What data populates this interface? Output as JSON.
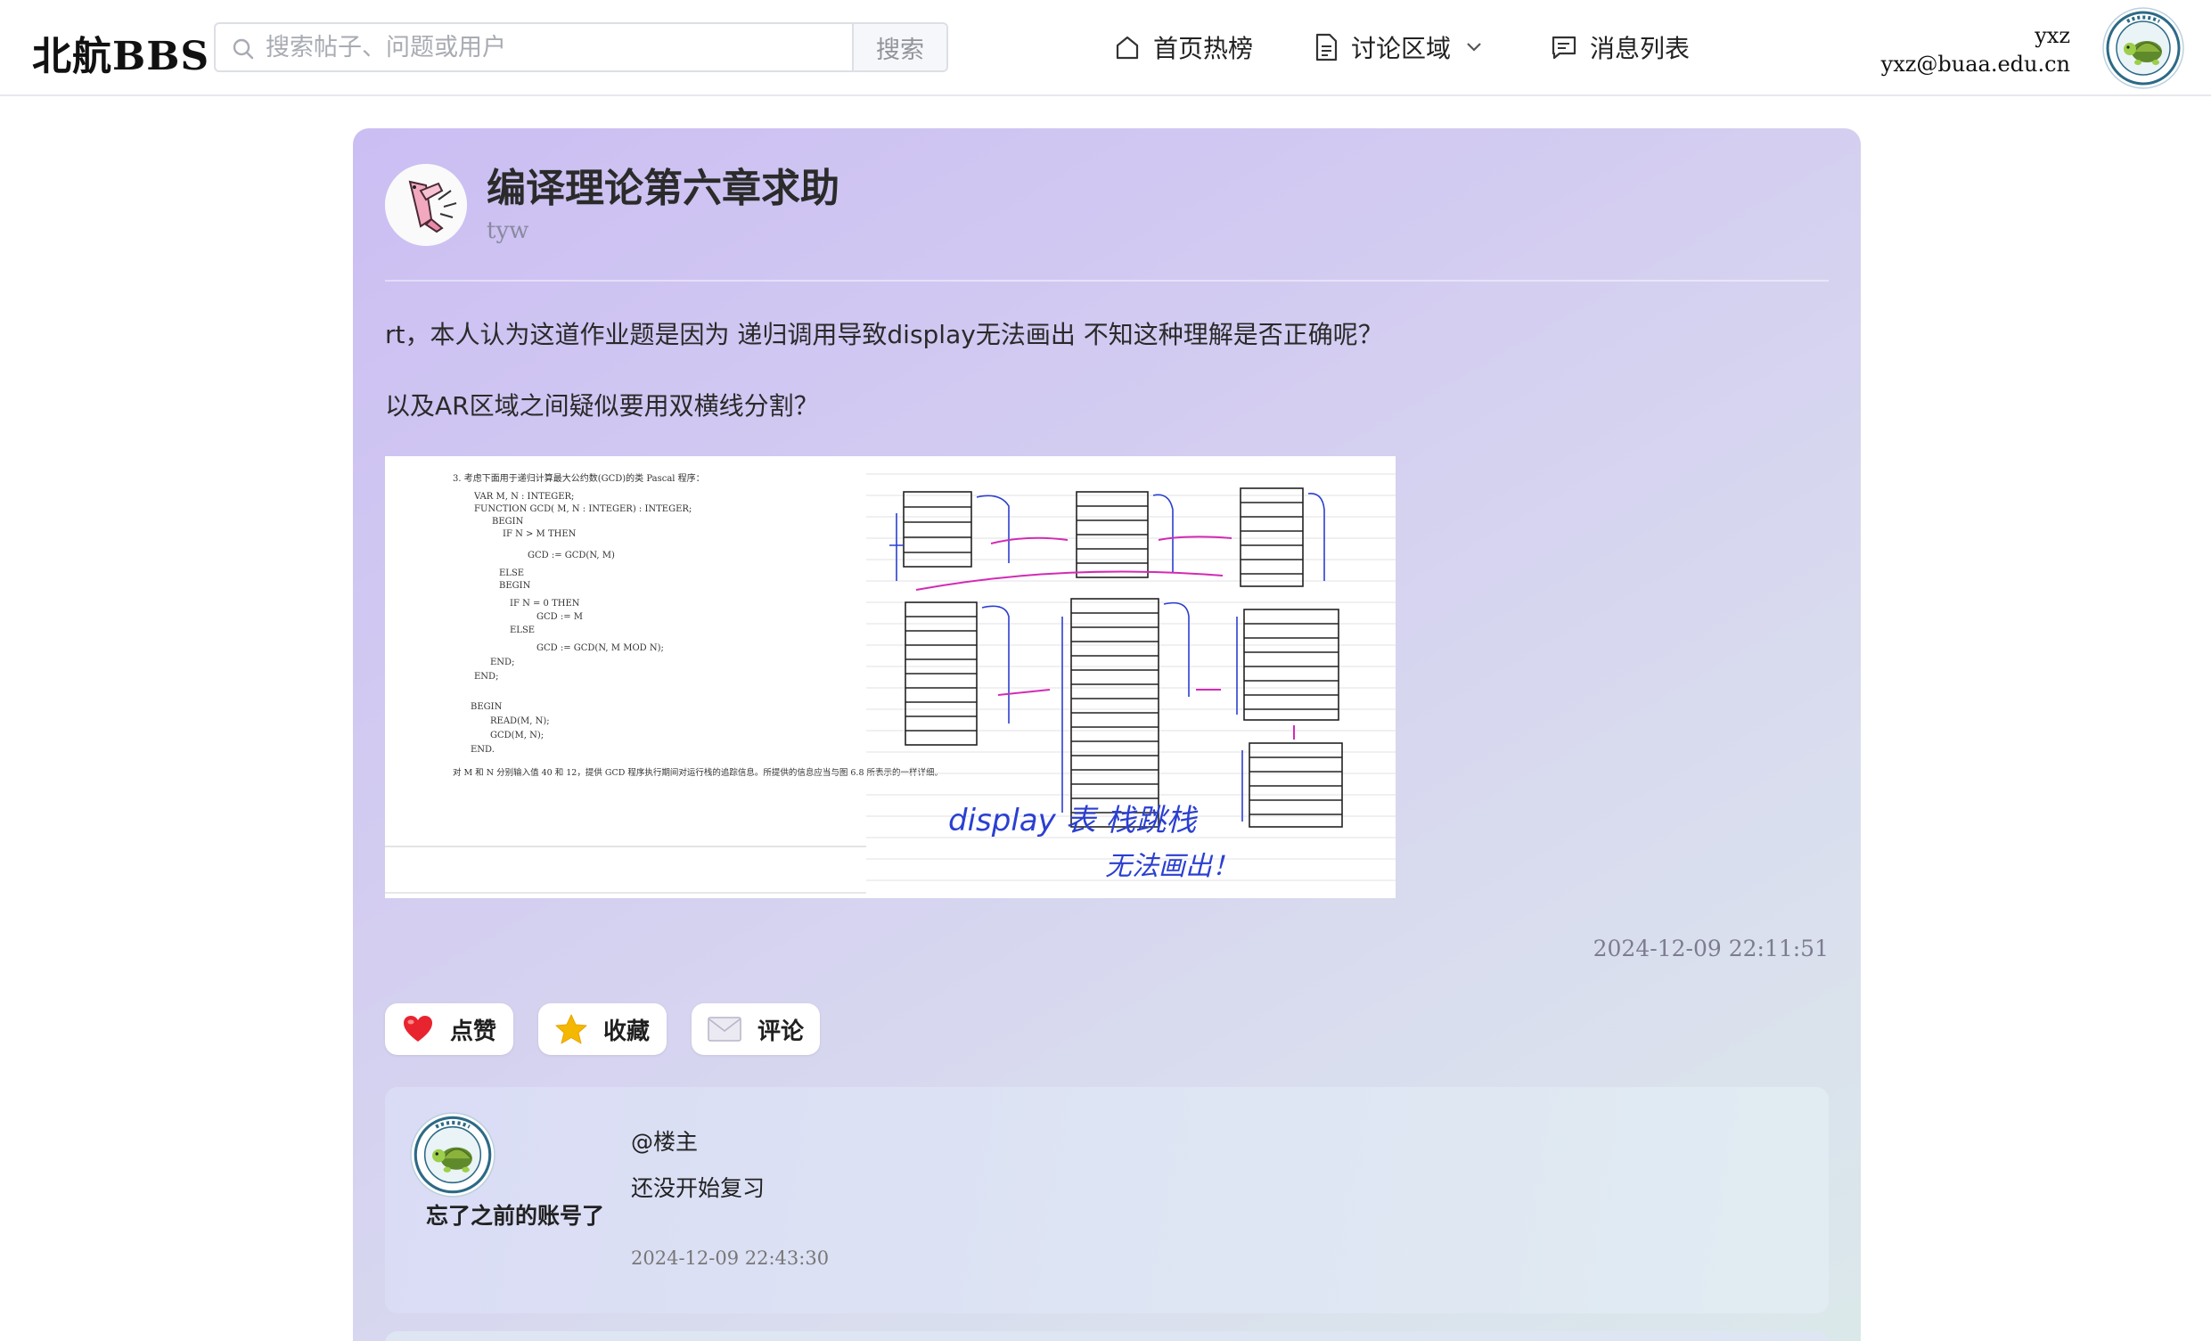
{
  "header": {
    "logo": "北航BBS",
    "search": {
      "placeholder": "搜索帖子、问题或用户",
      "button": "搜索"
    },
    "nav": [
      {
        "label": "首页热榜",
        "icon": "home-icon"
      },
      {
        "label": "讨论区域",
        "icon": "document-icon"
      },
      {
        "label": "消息列表",
        "icon": "message-icon"
      }
    ],
    "user": {
      "name": "yxz",
      "email": "yxz@buaa.edu.cn"
    }
  },
  "post": {
    "title": "编译理论第六章求助",
    "author": "tyw",
    "paragraphs": [
      "rt，本人认为这道作业题是因为 递归调用导致display无法画出 不知这种理解是否正确呢？",
      "以及AR区域之间疑似要用双横线分割？"
    ],
    "time": "2024-12-09 22:11:51",
    "image": {
      "question": "3. 考虑下面用于递归计算最大公约数(GCD)的类 Pascal 程序：",
      "code": [
        "VAR M, N : INTEGER;",
        "FUNCTION GCD( M, N : INTEGER) : INTEGER;",
        "BEGIN",
        "IF N > M THEN",
        "GCD := GCD(N, M)",
        "ELSE",
        "BEGIN",
        "IF N = 0 THEN",
        "GCD := M",
        "ELSE",
        "GCD := GCD(N, M MOD N);",
        "END;",
        "END;",
        "BEGIN",
        "READ(M, N);",
        "GCD(M, N);",
        "END."
      ],
      "footer": "对 M 和 N 分别输入值 40 和 12，提供 GCD 程序执行期间对运行栈的追踪信息。所提供的信息应当与图 6.8 所表示的一样详细。",
      "handwriting": [
        "display 表  栈跳栈",
        "无法画出！"
      ]
    }
  },
  "actions": [
    {
      "label": "点赞",
      "icon": "heart-icon",
      "color": "#e8242f"
    },
    {
      "label": "收藏",
      "icon": "star-icon",
      "color": "#f5b800"
    },
    {
      "label": "评论",
      "icon": "envelope-icon",
      "color": "#c9c6d8"
    }
  ],
  "comments": [
    {
      "name": "忘了之前的账号了",
      "mention": "@楼主",
      "text": "还没开始复习",
      "time": "2024-12-09 22:43:30"
    }
  ]
}
